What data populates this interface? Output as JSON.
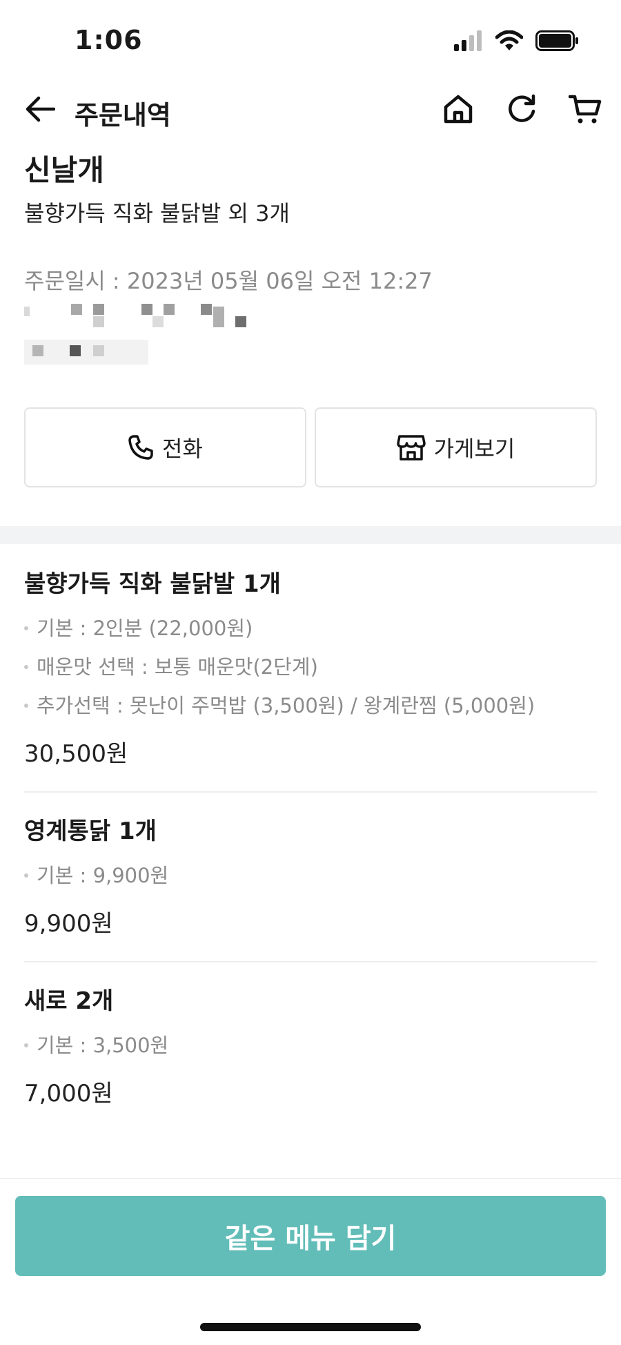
{
  "status_bar": {
    "time": "1:06"
  },
  "header": {
    "title": "주문내역"
  },
  "store": {
    "name": "신날개",
    "summary": "불향가득 직화 불닭발 외 3개",
    "order_date": "주문일시 : 2023년 05월 06일 오전 12:27"
  },
  "actions": {
    "call_label": "전화",
    "store_label": "가게보기"
  },
  "items": [
    {
      "name": "불향가득 직화 불닭발 1개",
      "options": [
        "기본 : 2인분 (22,000원)",
        "매운맛 선택 : 보통 매운맛(2단계)",
        "추가선택 : 못난이 주먹밥 (3,500원) / 왕계란찜 (5,000원)"
      ],
      "price": "30,500원"
    },
    {
      "name": "영계통닭 1개",
      "options": [
        "기본 : 9,900원"
      ],
      "price": "9,900원"
    },
    {
      "name": "새로 2개",
      "options": [
        "기본 : 3,500원"
      ],
      "price": "7,000원"
    }
  ],
  "cta": {
    "label": "같은 메뉴 담기"
  },
  "colors": {
    "accent": "#62bdb8",
    "muted_text": "#8b8b8b"
  }
}
